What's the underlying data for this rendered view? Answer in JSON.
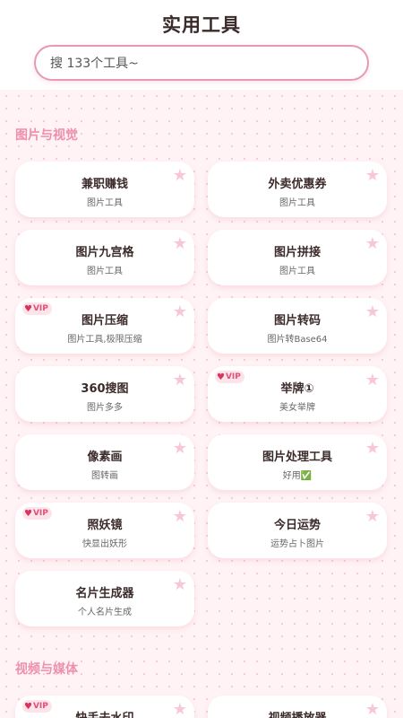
{
  "header": {
    "title": "实用工具",
    "search_placeholder": "搜 133个工具~"
  },
  "sections": [
    {
      "title": "图片与视觉",
      "tools": [
        {
          "name": "兼职赚钱",
          "desc": "图片工具",
          "vip": false
        },
        {
          "name": "外卖优惠券",
          "desc": "图片工具",
          "vip": false
        },
        {
          "name": "图片九宫格",
          "desc": "图片工具",
          "vip": false
        },
        {
          "name": "图片拼接",
          "desc": "图片工具",
          "vip": false
        },
        {
          "name": "图片压缩",
          "desc": "图片工具,极限压缩",
          "vip": true
        },
        {
          "name": "图片转码",
          "desc": "图片转Base64",
          "vip": false
        },
        {
          "name": "360搜图",
          "desc": "图片多多",
          "vip": false
        },
        {
          "name": "举牌①",
          "desc": "美女举牌",
          "vip": true
        },
        {
          "name": "像素画",
          "desc": "图转画",
          "vip": false
        },
        {
          "name": "图片处理工具",
          "desc": "好用✅",
          "vip": false
        },
        {
          "name": "照妖镜",
          "desc": "快显出妖形",
          "vip": true
        },
        {
          "name": "今日运势",
          "desc": "运势占卜图片",
          "vip": false
        },
        {
          "name": "名片生成器",
          "desc": "个人名片生成",
          "vip": false
        }
      ]
    },
    {
      "title": "视频与媒体",
      "tools": [
        {
          "name": "快手去水印",
          "desc": "",
          "vip": true
        },
        {
          "name": "视频播放器",
          "desc": "",
          "vip": false
        }
      ]
    }
  ],
  "labels": {
    "vip": "VIP",
    "star_icon": "★",
    "heart_icon": "♥"
  },
  "colors": {
    "accent": "#ee8fae",
    "border": "#e79aae",
    "star": "#f8c6d4",
    "vip_text": "#e0507a"
  }
}
